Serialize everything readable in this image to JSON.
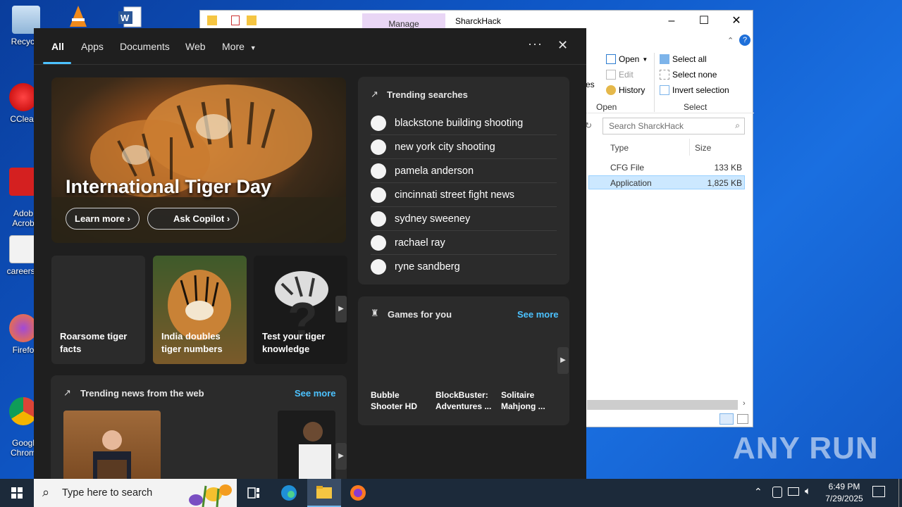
{
  "desktop": {
    "icons": [
      {
        "label": "Recycle",
        "icon": "recycle-bin-icon"
      },
      {
        "label": "CClear",
        "icon": "ccleaner-icon"
      },
      {
        "label": "Adob\nAcrob",
        "icon": "adobe-acrobat-icon"
      },
      {
        "label": "careersh",
        "icon": "document-icon"
      },
      {
        "label": "Firefo",
        "icon": "firefox-icon"
      },
      {
        "label": "Googl\nChrom",
        "icon": "chrome-icon"
      }
    ],
    "top_icons": [
      "vlc-icon",
      "word-icon"
    ]
  },
  "explorer": {
    "manage_tab": "Manage",
    "title": "SharckHack",
    "ribbon": {
      "open": "Open",
      "edit": "Edit",
      "history": "History",
      "properties_partial": "rties",
      "select_all": "Select all",
      "select_none": "Select none",
      "invert_selection": "Invert selection",
      "group_open": "Open",
      "group_select": "Select"
    },
    "search_placeholder": "Search SharckHack",
    "columns": {
      "type": "Type",
      "size": "Size"
    },
    "rows": [
      {
        "type": "CFG File",
        "size": "133 KB",
        "selected": false
      },
      {
        "type": "Application",
        "size": "1,825 KB",
        "selected": true
      }
    ]
  },
  "flyout": {
    "tabs": [
      "All",
      "Apps",
      "Documents",
      "Web",
      "More"
    ],
    "more_icon": "more-options-icon",
    "close_icon": "close-icon",
    "hero": {
      "title": "International Tiger Day",
      "learn_more": "Learn more",
      "ask_copilot": "Ask Copilot"
    },
    "cards": [
      {
        "caption": "Roarsome tiger facts"
      },
      {
        "caption": "India doubles tiger numbers"
      },
      {
        "caption": "Test your tiger knowledge"
      }
    ],
    "trending_searches": {
      "title": "Trending searches",
      "items": [
        "blackstone building shooting",
        "new york city shooting",
        "pamela anderson",
        "cincinnati street fight news",
        "sydney sweeney",
        "rachael ray",
        "ryne sandberg"
      ]
    },
    "games": {
      "title": "Games for you",
      "see_more": "See more",
      "items": [
        "Bubble Shooter HD",
        "BlockBuster: Adventures ...",
        "Solitaire Mahjong ..."
      ]
    },
    "news": {
      "title": "Trending news from the web",
      "see_more": "See more"
    }
  },
  "taskbar": {
    "search_placeholder": "Type here to search",
    "time": "6:49 PM",
    "date": "7/29/2025"
  },
  "watermark": "ANY RUN"
}
